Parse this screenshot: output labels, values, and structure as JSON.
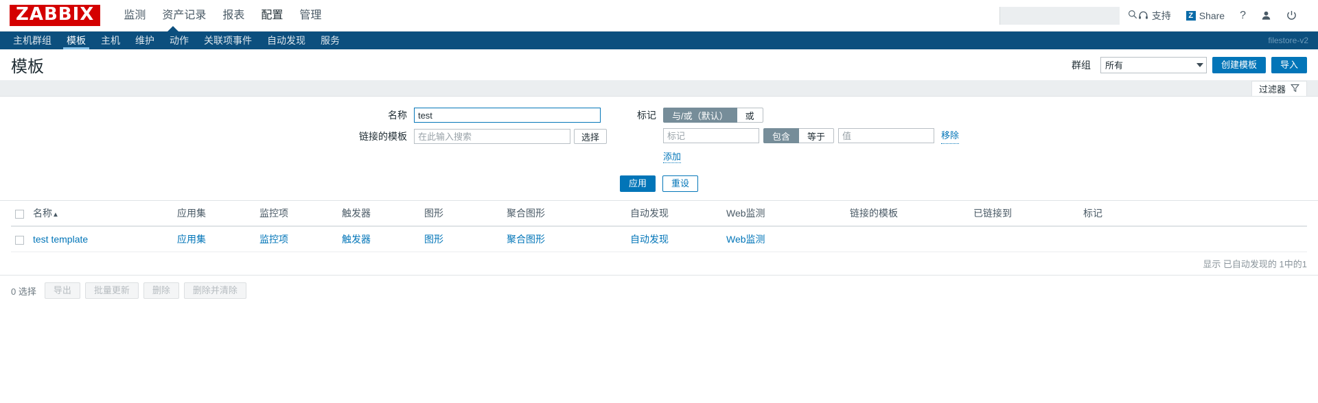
{
  "header": {
    "logo": "ZABBIX",
    "nav": [
      {
        "label": "监测",
        "selected": false
      },
      {
        "label": "资产记录",
        "selected": false
      },
      {
        "label": "报表",
        "selected": false
      },
      {
        "label": "配置",
        "selected": true
      },
      {
        "label": "管理",
        "selected": false
      }
    ],
    "search_placeholder": "",
    "search_value": "",
    "support_label": "支持",
    "share_label": "Share",
    "share_badge": "Z",
    "help_label": "?",
    "user_icon": "user-icon",
    "signout_icon": "power-icon"
  },
  "subnav": {
    "items": [
      {
        "label": "主机群组",
        "selected": false
      },
      {
        "label": "模板",
        "selected": true
      },
      {
        "label": "主机",
        "selected": false
      },
      {
        "label": "维护",
        "selected": false
      },
      {
        "label": "动作",
        "selected": false
      },
      {
        "label": "关联项事件",
        "selected": false
      },
      {
        "label": "自动发现",
        "selected": false
      },
      {
        "label": "服务",
        "selected": false
      }
    ],
    "server_label": "filestore-v2"
  },
  "title": {
    "page_title": "模板",
    "group_label": "群组",
    "group_value": "所有",
    "create_button": "创建模板",
    "import_button": "导入"
  },
  "filter": {
    "tab_label": "过滤器",
    "name_label": "名称",
    "name_value": "test",
    "linked_templates_label": "链接的模板",
    "linked_templates_placeholder": "在此输入搜索",
    "select_button": "选择",
    "tags_label": "标记",
    "evaltype": [
      {
        "label": "与/或（默认）",
        "selected": true
      },
      {
        "label": "或",
        "selected": false
      }
    ],
    "tag_placeholder": "标记",
    "operator": [
      {
        "label": "包含",
        "selected": true
      },
      {
        "label": "等于",
        "selected": false
      }
    ],
    "value_placeholder": "值",
    "remove_link": "移除",
    "add_link": "添加",
    "apply_button": "应用",
    "reset_button": "重设"
  },
  "table": {
    "columns": [
      "名称",
      "应用集",
      "监控项",
      "触发器",
      "图形",
      "聚合图形",
      "自动发现",
      "Web监测",
      "链接的模板",
      "已链接到",
      "标记"
    ],
    "sort_column": "名称",
    "sort_dir": "▲",
    "rows": [
      {
        "name": "test template",
        "applications": "应用集",
        "items": "监控项",
        "triggers": "触发器",
        "graphs": "图形",
        "screens": "聚合图形",
        "discovery": "自动发现",
        "web": "Web监测",
        "linked_templates": "",
        "linked_to": "",
        "tags": ""
      }
    ],
    "status_text": "显示 已自动发现的 1中的1"
  },
  "footer": {
    "selected_count": "0 选择",
    "buttons": [
      {
        "label": "导出",
        "disabled": true
      },
      {
        "label": "批量更新",
        "disabled": true
      },
      {
        "label": "删除",
        "disabled": true
      },
      {
        "label": "删除并清除",
        "disabled": true
      }
    ]
  },
  "colors": {
    "brand_red": "#d40000",
    "subnav_blue": "#0c4f7e",
    "accent_blue": "#0275b8",
    "seg_active": "#768d99"
  }
}
